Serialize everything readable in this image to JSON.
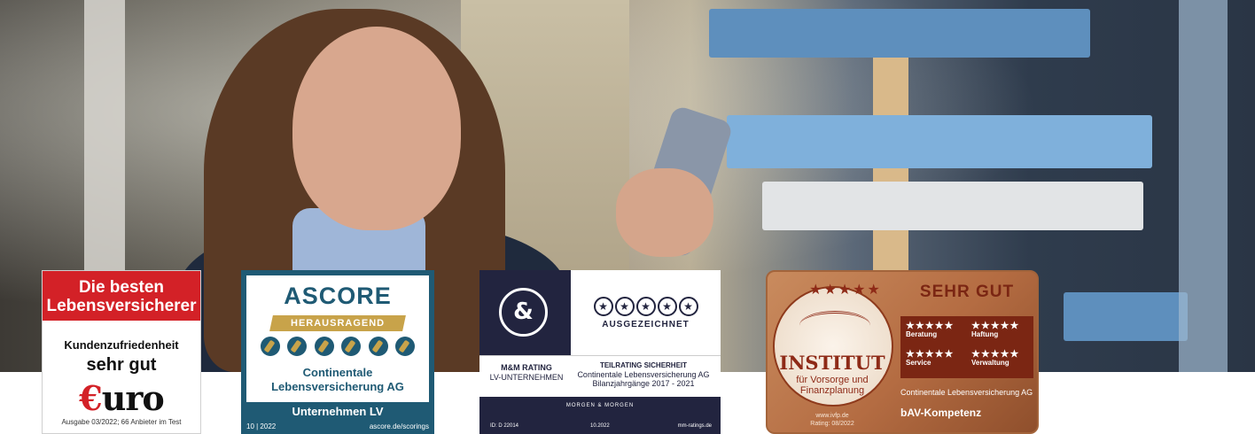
{
  "euro_badge": {
    "header": "Die besten Lebensversicherer",
    "category": "Kundenzufriedenheit",
    "grade": "sehr gut",
    "logo_prefix": "€",
    "logo_text": "uro",
    "footer": "Ausgabe 03/2022; 66 Anbieter im Test",
    "accent": "#d32127"
  },
  "ascore_badge": {
    "title": "ASCORE",
    "ribbon": "HERAUSRAGEND",
    "rating_count": 6,
    "company_line1": "Continentale",
    "company_line2": "Lebensversicherung AG",
    "segment": "Unternehmen LV",
    "date": "10 | 2022",
    "url": "ascore.de/scorings",
    "accent": "#1f5a74",
    "ribbon_color": "#c8a34a"
  },
  "mm_badge": {
    "logo_glyph": "&",
    "stars": 5,
    "award": "AUSGEZEICHNET",
    "rating_line1": "M&M RATING",
    "rating_line2": "LV-UNTERNEHMEN",
    "partial_title": "TEILRATING SICHERHEIT",
    "partial_company": "Continentale Lebensversicherung AG",
    "partial_years": "Bilanzjahrgänge 2017 - 2021",
    "brand": "MORGEN & MORGEN",
    "id": "ID: D 22014",
    "date": "10.2022",
    "url": "mm-ratings.de",
    "accent": "#22243f"
  },
  "ivfp_badge": {
    "grade": "SEHR GUT",
    "seal_title": "INSTITUT",
    "seal_sub1": "für Vorsorge und",
    "seal_sub2": "Finanzplanung",
    "website": "www.ivfp.de",
    "rating_date": "Rating: 08/2022",
    "criteria": [
      {
        "label": "Beratung",
        "stars": "★★★★★"
      },
      {
        "label": "Haftung",
        "stars": "★★★★★"
      },
      {
        "label": "Service",
        "stars": "★★★★★"
      },
      {
        "label": "Verwaltung",
        "stars": "★★★★★"
      }
    ],
    "company": "Continentale Lebensversicherung AG",
    "product": "bAV-Kompetenz",
    "accent": "#7b2613"
  }
}
